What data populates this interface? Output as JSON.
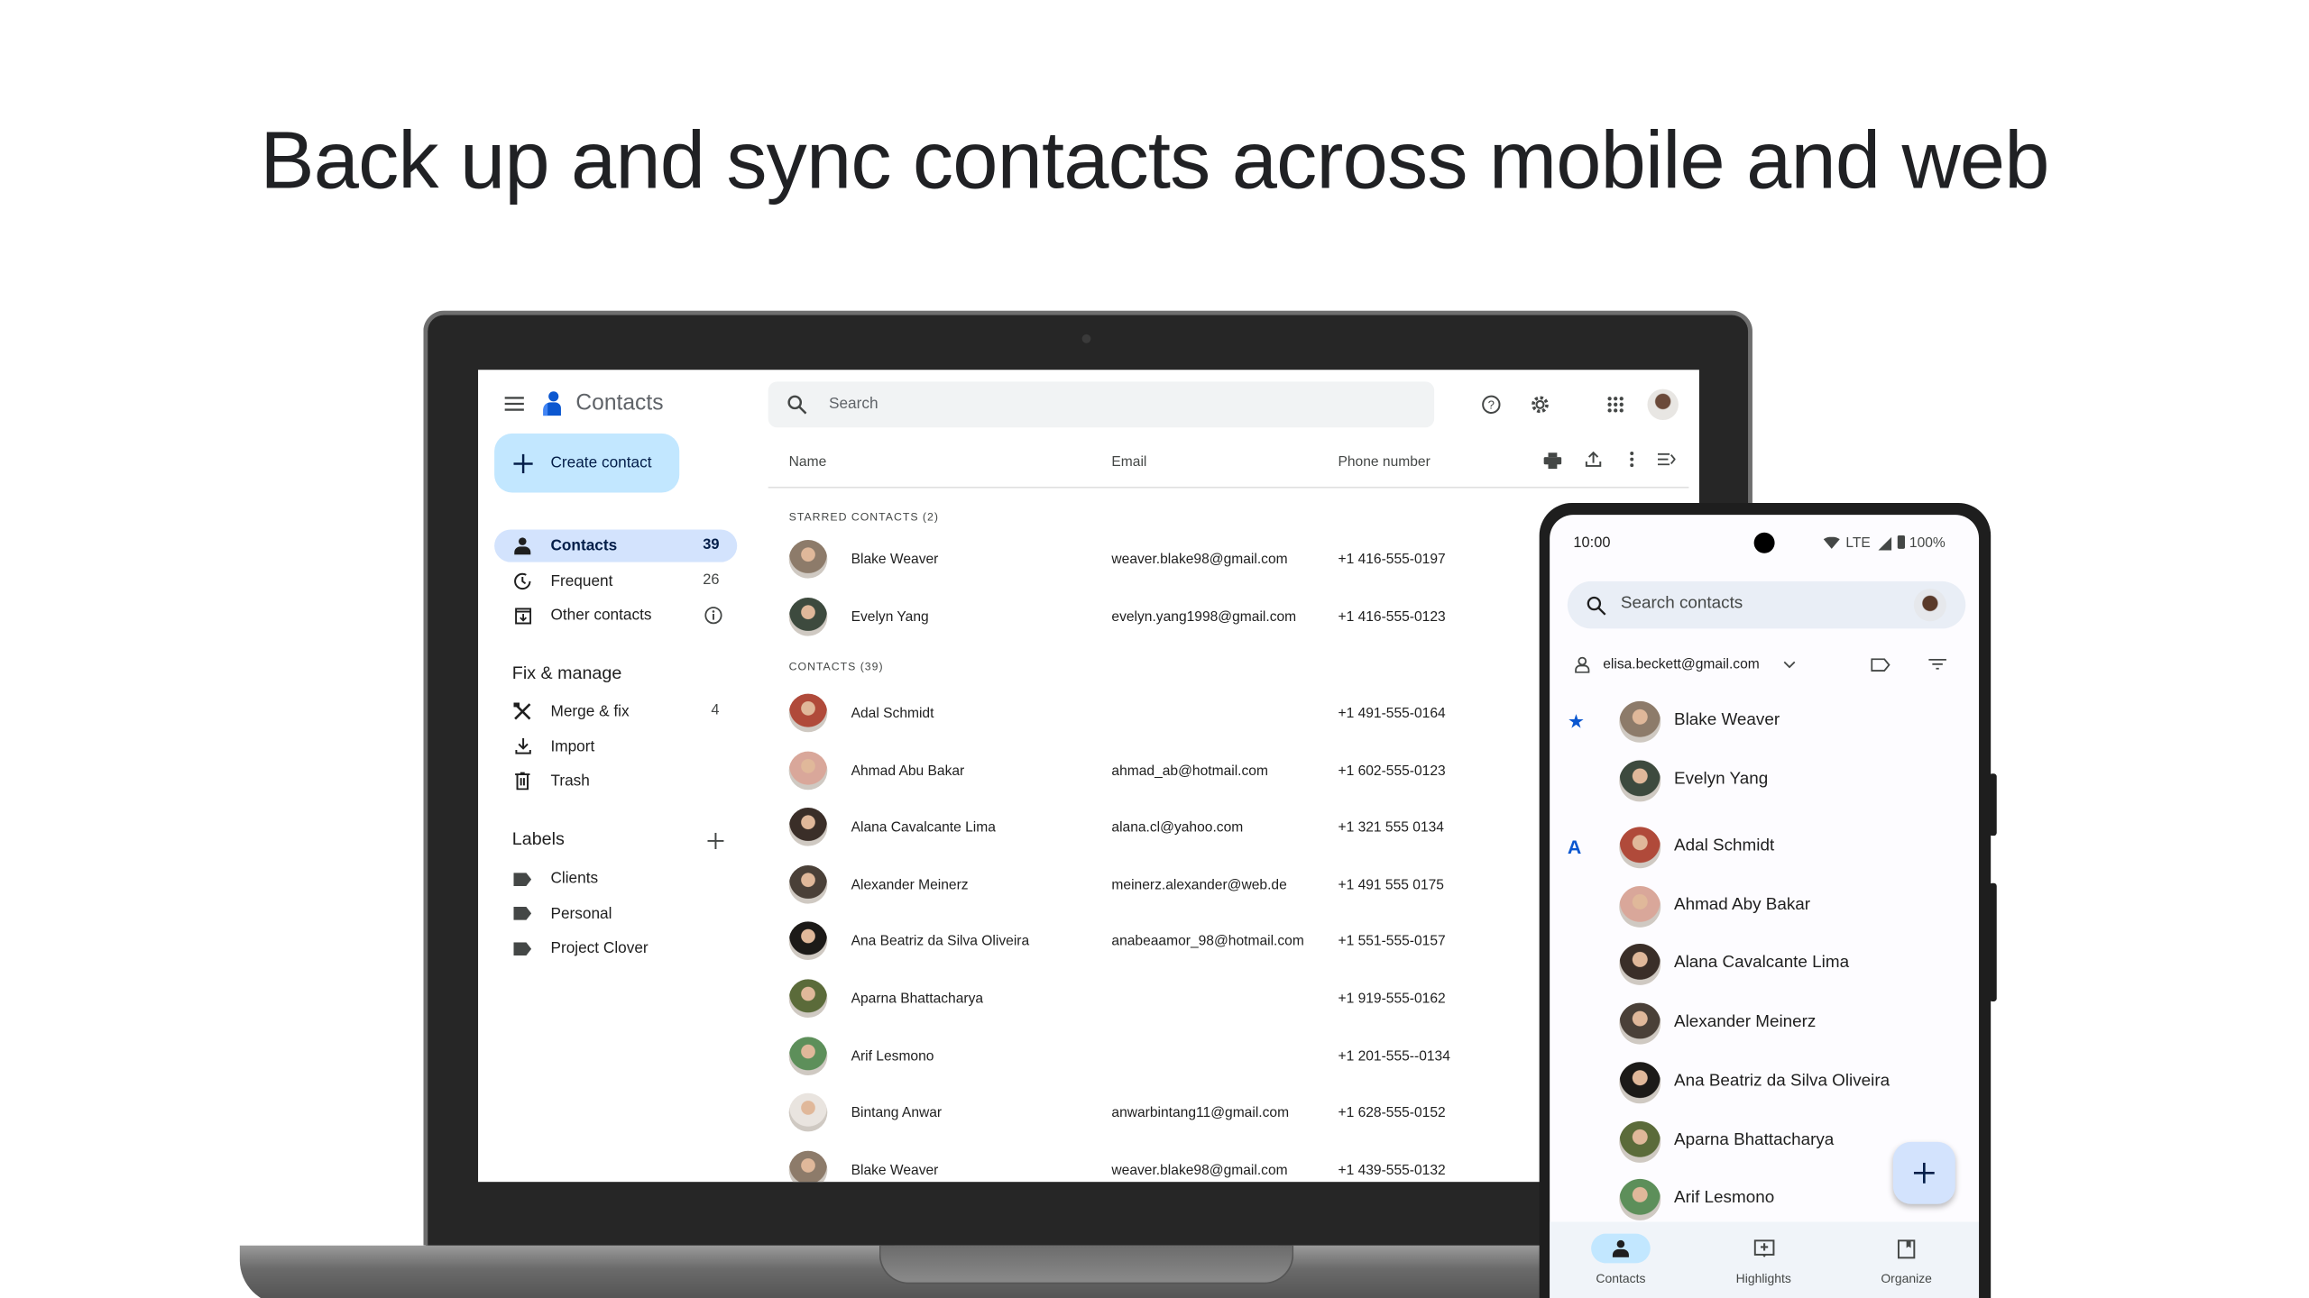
{
  "headline": "Back up and sync contacts across mobile and web",
  "web": {
    "app_title": "Contacts",
    "search_placeholder": "Search",
    "create_contact": "Create contact",
    "nav": [
      {
        "label": "Contacts",
        "count": "39",
        "icon": "person-icon",
        "active": true
      },
      {
        "label": "Frequent",
        "count": "26",
        "icon": "history-icon"
      },
      {
        "label": "Other contacts",
        "count": "",
        "icon": "archive-icon",
        "info": true
      }
    ],
    "fix_manage": {
      "title": "Fix & manage",
      "items": [
        {
          "label": "Merge & fix",
          "count": "4",
          "icon": "merge-tools-icon"
        },
        {
          "label": "Import",
          "count": "",
          "icon": "import-icon"
        },
        {
          "label": "Trash",
          "count": "",
          "icon": "trash-icon"
        }
      ]
    },
    "labels": {
      "title": "Labels",
      "items": [
        {
          "label": "Clients"
        },
        {
          "label": "Personal"
        },
        {
          "label": "Project Clover"
        }
      ]
    },
    "columns": {
      "name": "Name",
      "email": "Email",
      "phone": "Phone number"
    },
    "starred_header": "STARRED CONTACTS (2)",
    "contacts_header": "CONTACTS (39)",
    "starred": [
      {
        "name": "Blake Weaver",
        "email": "weaver.blake98@gmail.com",
        "phone": "+1 416-555-0197",
        "color": "#8d7b6a"
      },
      {
        "name": "Evelyn Yang",
        "email": "evelyn.yang1998@gmail.com",
        "phone": "+1 416-555-0123",
        "color": "#3d4a3e"
      }
    ],
    "contacts": [
      {
        "name": "Adal Schmidt",
        "email": "",
        "phone": "+1 491-555-0164",
        "color": "#b04a3a"
      },
      {
        "name": "Ahmad Abu Bakar",
        "email": "ahmad_ab@hotmail.com",
        "phone": "+1 602-555-0123",
        "color": "#d9a79a"
      },
      {
        "name": "Alana Cavalcante Lima",
        "email": "alana.cl@yahoo.com",
        "phone": "+1 321 555 0134",
        "color": "#3a2e28"
      },
      {
        "name": "Alexander Meinerz",
        "email": "meinerz.alexander@web.de",
        "phone": "+1 491 555 0175",
        "color": "#4a4038"
      },
      {
        "name": "Ana Beatriz da Silva Oliveira",
        "email": "anabeaamor_98@hotmail.com",
        "phone": "+1  551-555-0157",
        "color": "#1c1a18"
      },
      {
        "name": "Aparna Bhattacharya",
        "email": "",
        "phone": "+1  919-555-0162",
        "color": "#5b6b3a"
      },
      {
        "name": "Arif Lesmono",
        "email": "",
        "phone": "+1  201-555--0134",
        "color": "#5d8f5a"
      },
      {
        "name": "Bintang Anwar",
        "email": "anwarbintang11@gmail.com",
        "phone": "+1  628-555-0152",
        "color": "#e9e4df"
      },
      {
        "name": "Blake Weaver",
        "email": "weaver.blake98@gmail.com",
        "phone": "+1  439-555-0132",
        "color": "#8d7b6a"
      }
    ]
  },
  "mobile": {
    "time": "10:00",
    "status": "LTE",
    "battery": "100%",
    "search_placeholder": "Search contacts",
    "account": "elisa.beckett@gmail.com",
    "list": [
      {
        "name": "Blake Weaver",
        "marker": "★",
        "color": "#8d7b6a"
      },
      {
        "name": "Evelyn Yang",
        "marker": "",
        "color": "#3d4a3e"
      },
      {
        "name": "Adal Schmidt",
        "marker": "A",
        "color": "#b04a3a"
      },
      {
        "name": "Ahmad Aby Bakar",
        "marker": "",
        "color": "#d9a79a"
      },
      {
        "name": "Alana Cavalcante Lima",
        "marker": "",
        "color": "#3a2e28"
      },
      {
        "name": "Alexander Meinerz",
        "marker": "",
        "color": "#4a4038"
      },
      {
        "name": "Ana Beatriz da Silva Oliveira",
        "marker": "",
        "color": "#1c1a18"
      },
      {
        "name": "Aparna Bhattacharya",
        "marker": "",
        "color": "#5b6b3a"
      },
      {
        "name": "Arif Lesmono",
        "marker": "",
        "color": "#5d8f5a"
      }
    ],
    "bottom_nav": [
      {
        "label": "Contacts",
        "icon": "person-icon",
        "active": true
      },
      {
        "label": "Highlights",
        "icon": "highlights-icon"
      },
      {
        "label": "Organize",
        "icon": "organize-icon"
      }
    ]
  },
  "colors": {
    "accent": "#0b57d0",
    "nav_active": "#d3e3fd",
    "create_button": "#c2e7ff"
  }
}
